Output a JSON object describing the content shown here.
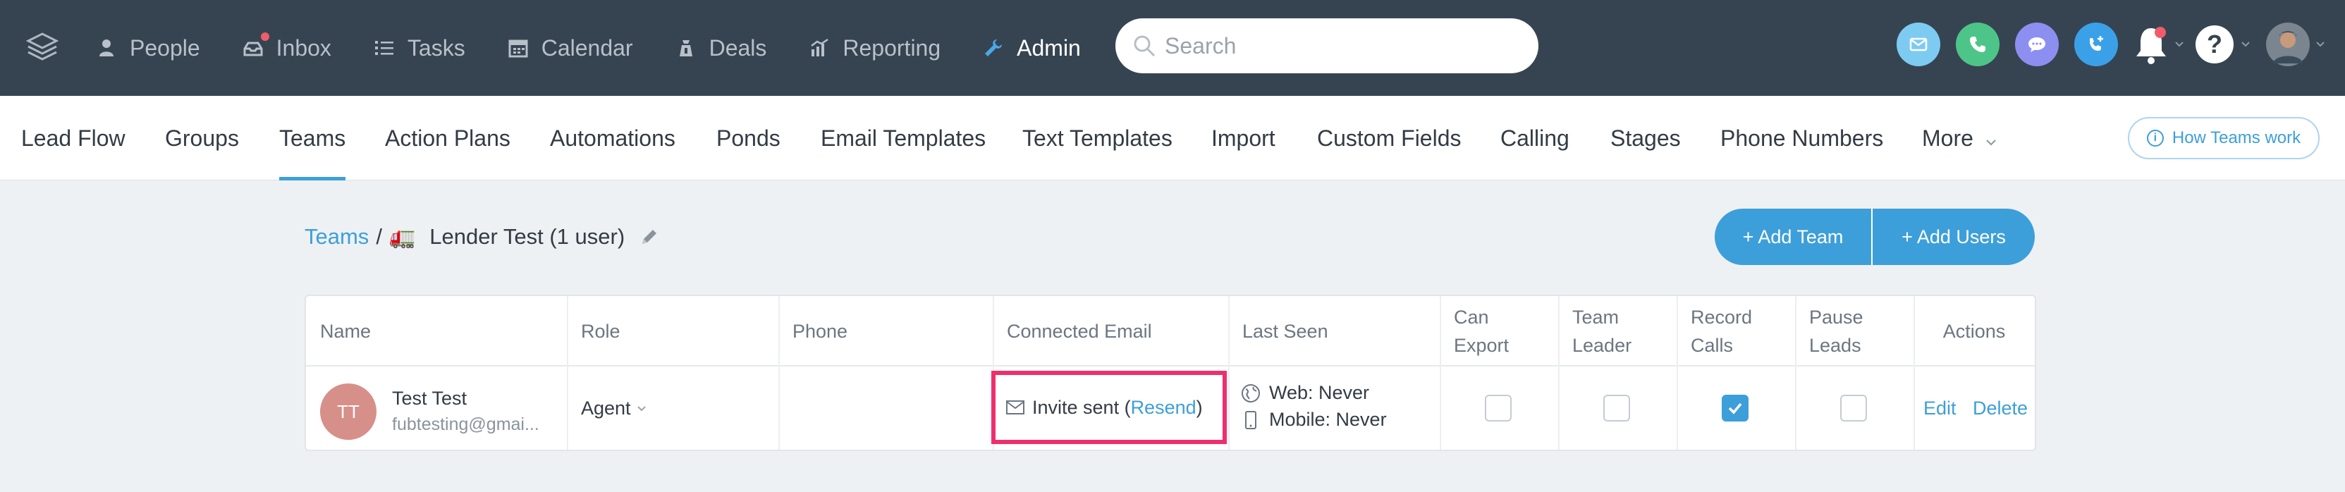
{
  "topnav": {
    "items": [
      {
        "label": "People",
        "icon": "people-icon"
      },
      {
        "label": "Inbox",
        "icon": "inbox-icon",
        "badge": true
      },
      {
        "label": "Tasks",
        "icon": "tasks-icon"
      },
      {
        "label": "Calendar",
        "icon": "calendar-icon"
      },
      {
        "label": "Deals",
        "icon": "deals-icon"
      },
      {
        "label": "Reporting",
        "icon": "reporting-icon"
      },
      {
        "label": "Admin",
        "icon": "wrench-icon",
        "active": true
      }
    ],
    "search_placeholder": "Search"
  },
  "subnav": {
    "items": [
      "Lead Flow",
      "Groups",
      "Teams",
      "Action Plans",
      "Automations",
      "Ponds",
      "Email Templates",
      "Text Templates",
      "Import",
      "Custom Fields",
      "Calling",
      "Stages",
      "Phone Numbers",
      "More"
    ],
    "active": "Teams",
    "help_button": "How Teams work"
  },
  "breadcrumb": {
    "root": "Teams",
    "separator": "/",
    "emoji": "🚛",
    "current": "Lender Test (1 user)"
  },
  "buttons": {
    "add_team": "+ Add Team",
    "add_users": "+ Add Users"
  },
  "table": {
    "headers": {
      "name": "Name",
      "role": "Role",
      "phone": "Phone",
      "email": "Connected Email",
      "seen": "Last Seen",
      "export_1": "Can",
      "export_2": "Export",
      "leader_1": "Team",
      "leader_2": "Leader",
      "record_1": "Record",
      "record_2": "Calls",
      "pause_1": "Pause",
      "pause_2": "Leads",
      "actions": "Actions"
    },
    "row": {
      "initials": "TT",
      "name": "Test Test",
      "email": "fubtesting@gmai...",
      "role": "Agent",
      "phone": "",
      "invite_prefix": "Invite sent (",
      "resend": "Resend",
      "invite_suffix": ")",
      "web_seen": "Web: Never",
      "mobile_seen": "Mobile: Never",
      "can_export": false,
      "team_leader": false,
      "record_calls": true,
      "pause_leads": false,
      "edit": "Edit",
      "delete": "Delete"
    }
  },
  "colors": {
    "topbar": "#364452",
    "accent": "#3d9fd9",
    "highlight": "#ef2f6c",
    "avatar": "#d78f8a"
  }
}
